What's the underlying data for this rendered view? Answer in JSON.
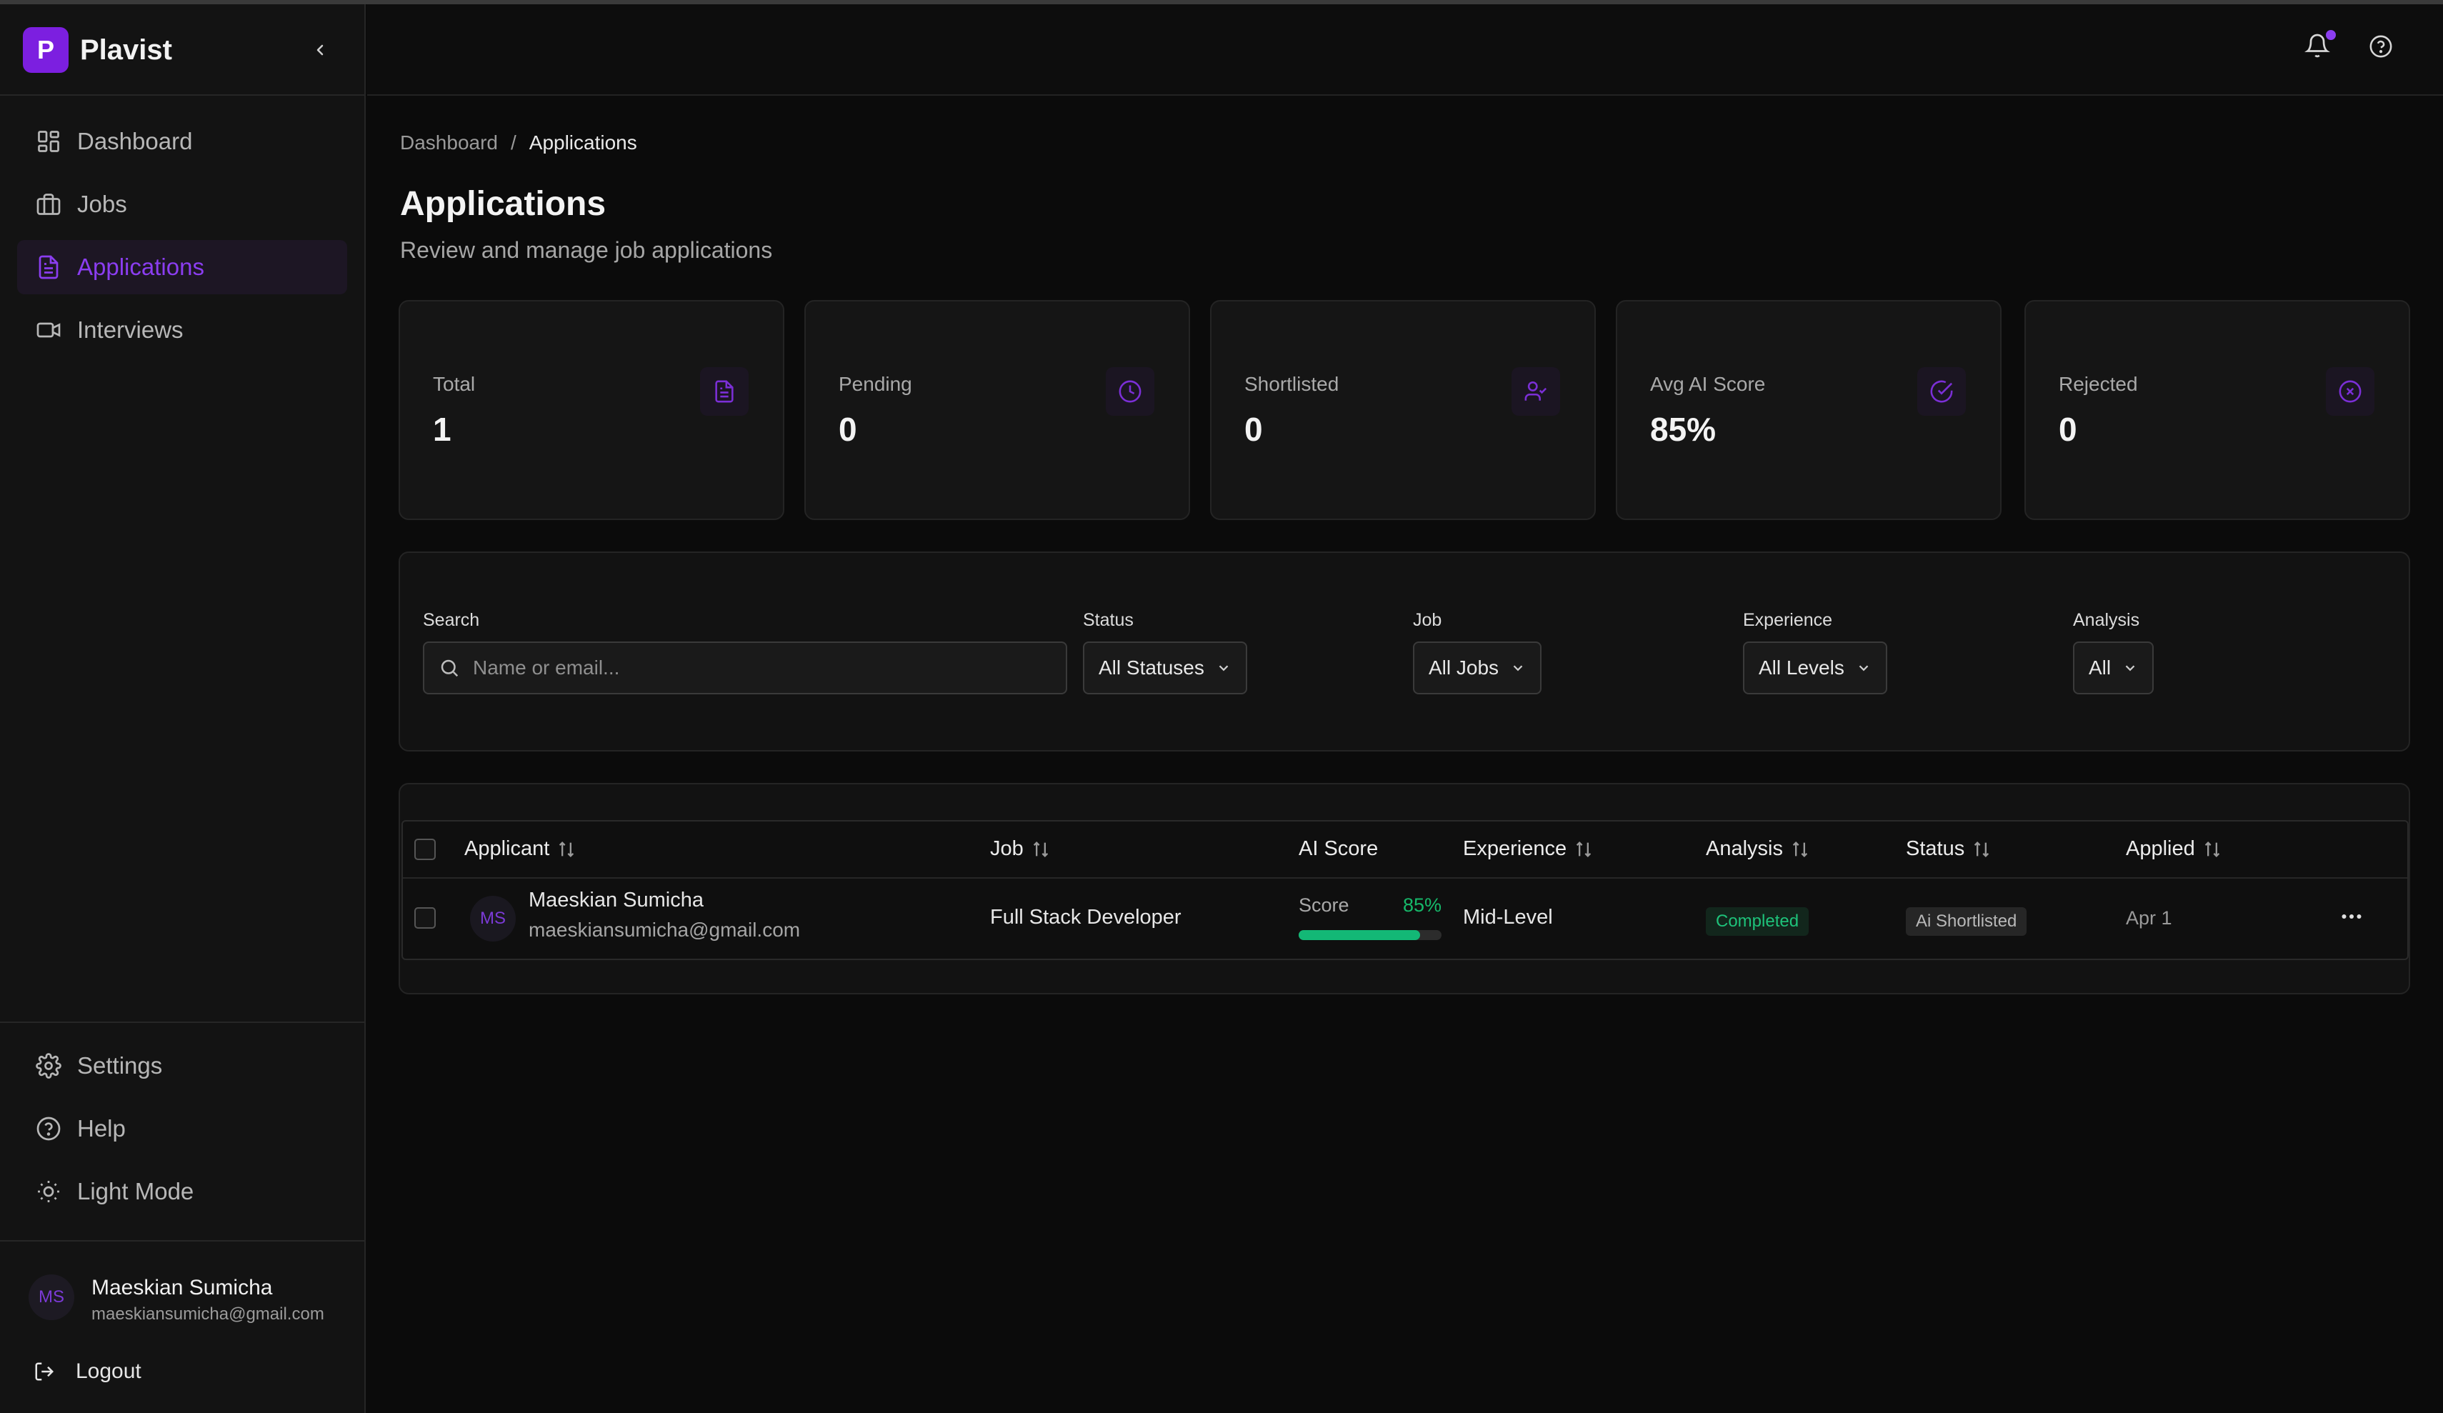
{
  "brand": {
    "logo_letter": "P",
    "name": "Plavist"
  },
  "nav": {
    "items": [
      {
        "label": "Dashboard",
        "icon": "grid-icon"
      },
      {
        "label": "Jobs",
        "icon": "briefcase-icon"
      },
      {
        "label": "Applications",
        "icon": "document-icon",
        "active": true
      },
      {
        "label": "Interviews",
        "icon": "video-icon"
      }
    ],
    "bottom": [
      {
        "label": "Settings",
        "icon": "gear-icon"
      },
      {
        "label": "Help",
        "icon": "help-circle-icon"
      },
      {
        "label": "Light Mode",
        "icon": "sun-icon"
      }
    ]
  },
  "profile": {
    "initials": "MS",
    "name": "Maeskian Sumicha",
    "email": "maeskiansumicha@gmail.com",
    "logout": "Logout"
  },
  "breadcrumb": {
    "root": "Dashboard",
    "sep": "/",
    "current": "Applications"
  },
  "header": {
    "title": "Applications",
    "subtitle": "Review and manage job applications"
  },
  "stats": [
    {
      "label": "Total",
      "value": "1",
      "icon": "file-text-icon"
    },
    {
      "label": "Pending",
      "value": "0",
      "icon": "clock-icon"
    },
    {
      "label": "Shortlisted",
      "value": "0",
      "icon": "user-check-icon"
    },
    {
      "label": "Avg AI Score",
      "value": "85%",
      "icon": "check-circle-icon"
    },
    {
      "label": "Rejected",
      "value": "0",
      "icon": "x-circle-icon"
    }
  ],
  "filters": {
    "search_label": "Search",
    "search_placeholder": "Name or email...",
    "status_label": "Status",
    "status_value": "All Statuses",
    "job_label": "Job",
    "job_value": "All Jobs",
    "experience_label": "Experience",
    "experience_value": "All Levels",
    "analysis_label": "Analysis",
    "analysis_value": "All"
  },
  "table": {
    "columns": [
      "Applicant",
      "Job",
      "AI Score",
      "Experience",
      "Analysis",
      "Status",
      "Applied"
    ],
    "rows": [
      {
        "initials": "MS",
        "name": "Maeskian Sumicha",
        "email": "maeskiansumicha@gmail.com",
        "job": "Full Stack Developer",
        "score_label": "Score",
        "score_pct": "85%",
        "score_fraction": 0.85,
        "experience": "Mid-Level",
        "analysis": "Completed",
        "status": "Ai Shortlisted",
        "applied": "Apr 1"
      }
    ]
  },
  "colors": {
    "accent": "#8b3df0",
    "success": "#16b86a"
  }
}
